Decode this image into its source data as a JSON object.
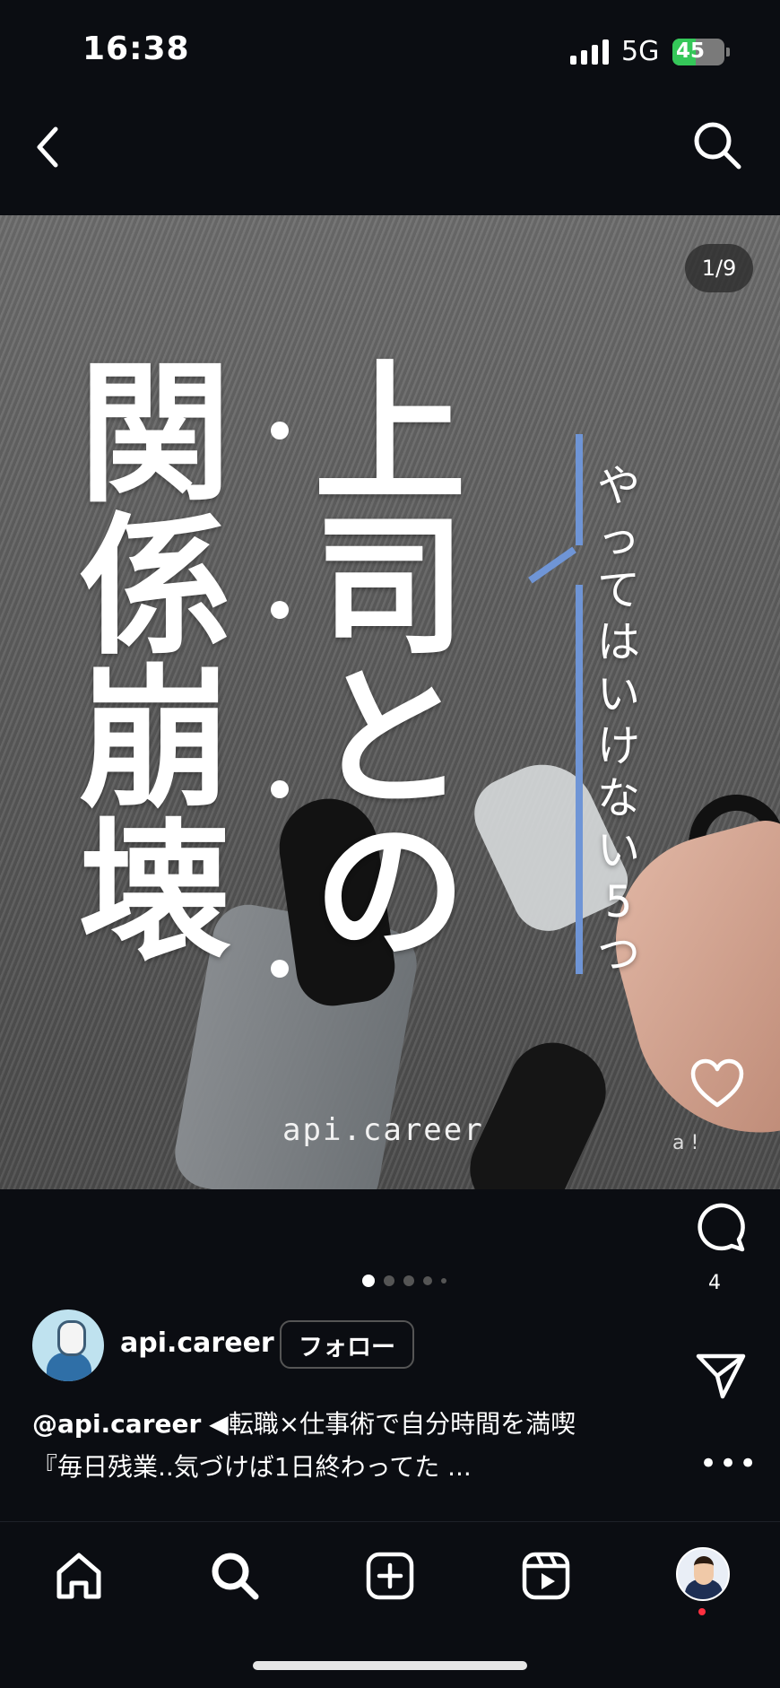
{
  "status_bar": {
    "time": "16:38",
    "network": "5G",
    "battery": "45",
    "battery_level": 0.45
  },
  "post": {
    "image_counter": "1/9",
    "image_text": {
      "left_column": [
        "関",
        "係",
        "崩",
        "壊"
      ],
      "middle_column": [
        "上",
        "司",
        "と",
        "の"
      ],
      "right_column": [
        "や",
        "っ",
        "て",
        "は",
        "い",
        "け",
        "な",
        "い",
        "5",
        "つ"
      ],
      "watermark": "api.career",
      "hint": "a !"
    },
    "comment_count": "4",
    "carousel_pages": 5,
    "carousel_current": 1
  },
  "author": {
    "name": "api.career",
    "follow_label": "フォロー"
  },
  "caption": {
    "handle": "@api.career",
    "line1": "◀転職×仕事術で自分時間を満喫",
    "line2": "『毎日残業..気づけば1日終わってた ..."
  },
  "colors": {
    "background": "#0b0d12",
    "accent_line": "#6f95d6",
    "notification": "#ff3040",
    "battery": "#35c759"
  },
  "icons": [
    "back-icon",
    "search-icon",
    "heart-icon",
    "comment-icon",
    "share-icon",
    "more-icon",
    "home-icon",
    "add-icon",
    "reels-icon"
  ]
}
